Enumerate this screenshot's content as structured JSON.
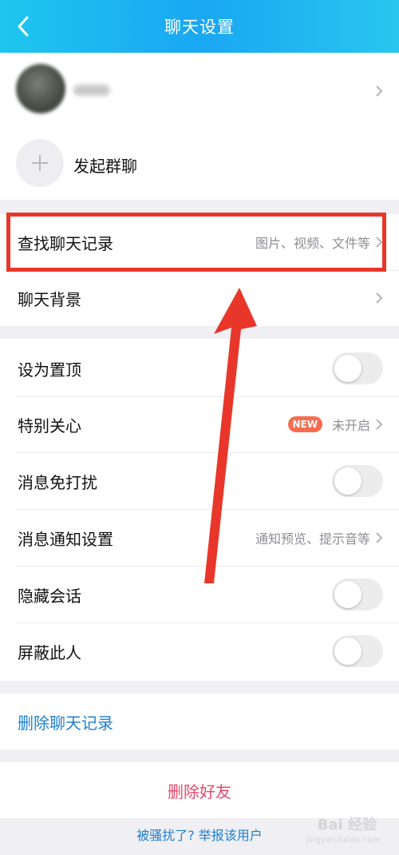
{
  "header": {
    "title": "聊天设置"
  },
  "group": {
    "label": "发起群聊"
  },
  "rows": {
    "search": {
      "label": "查找聊天记录",
      "hint": "图片、视频、文件等"
    },
    "background": {
      "label": "聊天背景"
    },
    "pin": {
      "label": "设为置顶",
      "on": false
    },
    "special": {
      "label": "特别关心",
      "badge": "NEW",
      "hint": "未开启"
    },
    "mute": {
      "label": "消息免打扰",
      "on": false
    },
    "notify": {
      "label": "消息通知设置",
      "hint": "通知预览、提示音等"
    },
    "hide": {
      "label": "隐藏会话",
      "on": false
    },
    "block": {
      "label": "屏蔽此人",
      "on": false
    }
  },
  "actions": {
    "delete_records": "删除聊天记录",
    "delete_friend": "删除好友",
    "report": "被骚扰了? 举报该用户"
  },
  "watermark": {
    "text": "Bai 经验",
    "sub": "jingyan.baidu.com"
  },
  "colors": {
    "header": "#1aa7f3",
    "highlight": "#e8372a",
    "arrow": "#e8372a",
    "link": "#1f7fd0",
    "danger": "#e5486a",
    "badge": "#f56d50"
  }
}
